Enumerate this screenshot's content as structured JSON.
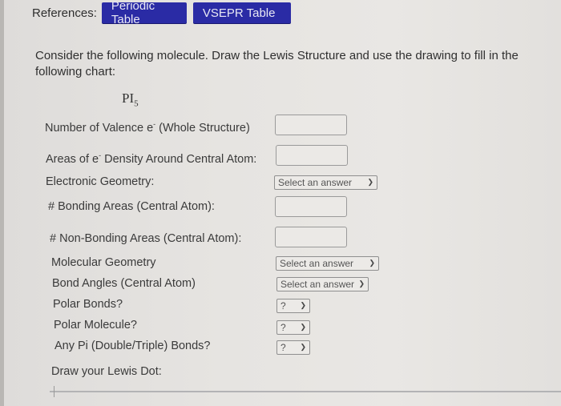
{
  "references": {
    "label": "References:",
    "buttons": [
      {
        "label": "Periodic Table"
      },
      {
        "label": "VSEPR Table"
      }
    ],
    "button_color": "#2a2ba5"
  },
  "question": {
    "text": "Consider the following molecule. Draw the Lewis Structure and use the drawing to fill in the following chart:",
    "formula_base": "PI",
    "formula_sub": "5"
  },
  "form": {
    "valence": {
      "label_a": "Number of Valence e",
      "sup": "-",
      "label_b": " (Whole Structure)",
      "value": ""
    },
    "density": {
      "label_a": "Areas of e",
      "sup": "-",
      "label_b": " Density Around Central Atom:",
      "value": ""
    },
    "electronic_geometry": {
      "label": "Electronic Geometry:",
      "selected": "Select an answer"
    },
    "bonding_areas": {
      "label": "# Bonding Areas (Central Atom):",
      "value": ""
    },
    "nonbonding_areas": {
      "label": "# Non-Bonding Areas (Central Atom):",
      "value": ""
    },
    "molecular_geometry": {
      "label": "Molecular Geometry",
      "selected": "Select an answer"
    },
    "bond_angles": {
      "label": "Bond Angles (Central Atom)",
      "selected": "Select an answer"
    },
    "polar_bonds": {
      "label": "Polar Bonds?",
      "selected": "?"
    },
    "polar_molecule": {
      "label": "Polar Molecule?",
      "selected": "?"
    },
    "pi_bonds": {
      "label": "Any Pi (Double/Triple) Bonds?",
      "selected": "?"
    },
    "draw": {
      "label": "Draw your Lewis Dot:"
    }
  },
  "icons": {
    "chevron": "chevron-down"
  }
}
